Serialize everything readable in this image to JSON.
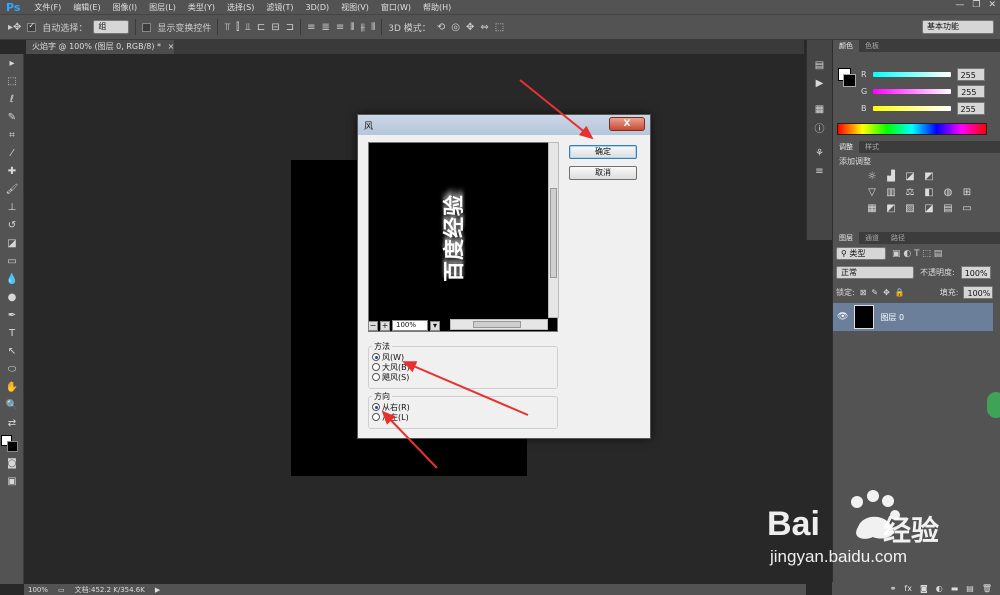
{
  "menubar": {
    "logo": "Ps",
    "items": [
      "文件(F)",
      "编辑(E)",
      "图像(I)",
      "图层(L)",
      "类型(Y)",
      "选择(S)",
      "滤镜(T)",
      "3D(D)",
      "视图(V)",
      "窗口(W)",
      "帮助(H)"
    ]
  },
  "options": {
    "auto_select_label": "自动选择：",
    "auto_select_value": "组",
    "show_transform_label": "显示变换控件",
    "mode_3d_label": "3D 模式：",
    "workspace": "基本功能"
  },
  "document": {
    "tab_title": "火焰字 @ 100% (图层 0, RGB/8) *",
    "tab_close": "×"
  },
  "status": {
    "zoom": "100%",
    "doc_info": "文档:452.2 K/354.6K"
  },
  "color_panel": {
    "tabs": [
      "颜色",
      "色板"
    ],
    "rows": [
      {
        "label": "R",
        "value": "255",
        "color": "#00ffff"
      },
      {
        "label": "G",
        "value": "255",
        "color": "#ff00ff"
      },
      {
        "label": "B",
        "value": "255",
        "color": "#ffff00"
      }
    ]
  },
  "adjust_panel": {
    "tabs": [
      "调整",
      "样式"
    ],
    "title": "添加调整"
  },
  "layers_panel": {
    "tabs": [
      "图层",
      "通道",
      "路径"
    ],
    "filter": "类型",
    "blend_mode": "正常",
    "opacity_label": "不透明度:",
    "opacity_value": "100%",
    "lock_label": "锁定:",
    "fill_label": "填充:",
    "fill_value": "100%",
    "layer_name": "图层 0"
  },
  "dialog": {
    "title": "风",
    "close": "X",
    "preview_text": "百度经验",
    "zoom": "100%",
    "ok": "确定",
    "cancel": "取消",
    "method_label": "方法",
    "methods": [
      "风(W)",
      "大风(B)",
      "飓风(S)"
    ],
    "method_selected": "风(W)",
    "direction_label": "方向",
    "directions": [
      "从右(R)",
      "从左(L)"
    ],
    "direction_selected": "从右(R)"
  },
  "watermark": {
    "brand": "Bai",
    "brand2": "经验",
    "url": "jingyan.baidu.com"
  },
  "colors": {
    "accent_arrow": "#e8312f",
    "layer_selected": "#6b7f9b"
  }
}
